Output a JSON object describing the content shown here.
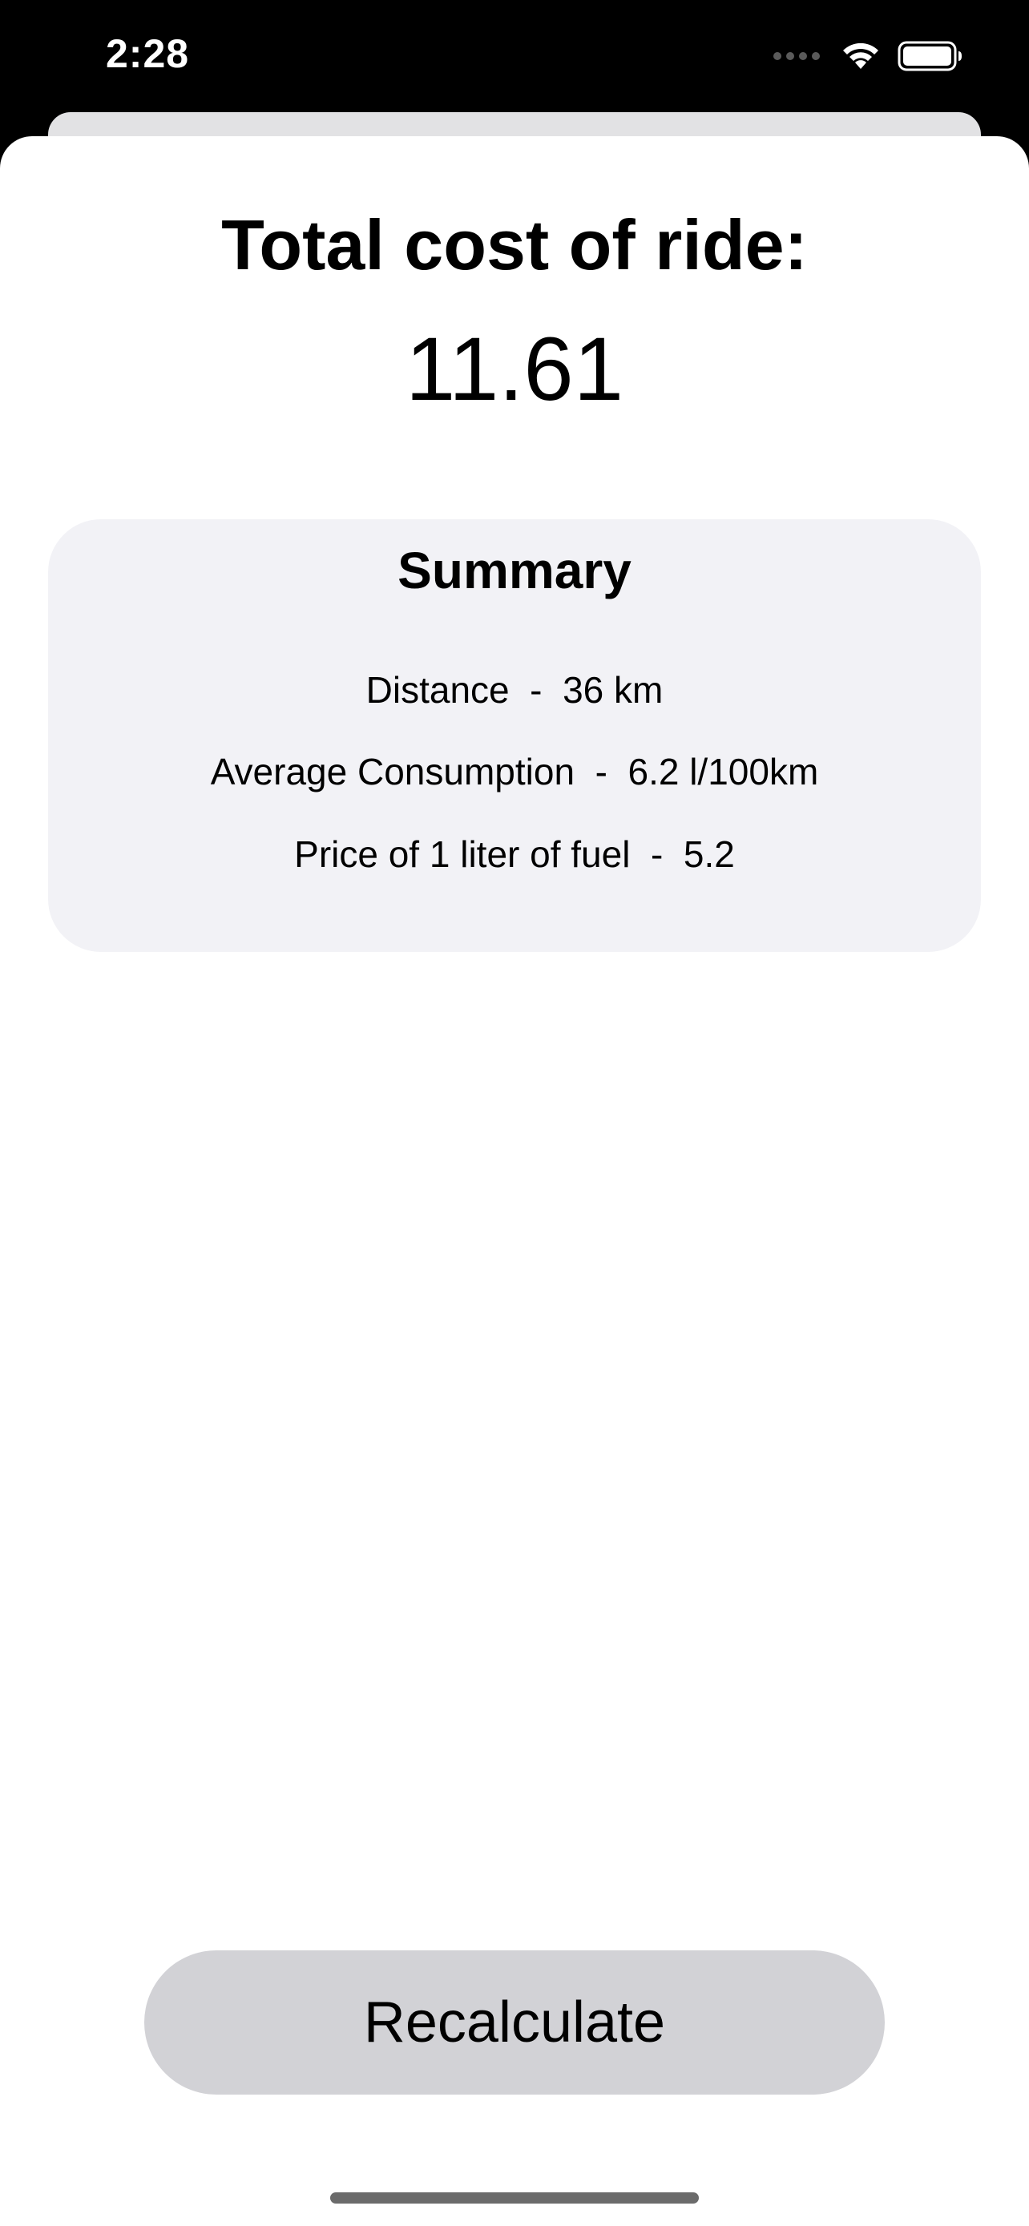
{
  "status_bar": {
    "time": "2:28",
    "icons": [
      "signal-dots-icon",
      "wifi-icon",
      "battery-icon"
    ]
  },
  "result": {
    "title": "Total cost of ride:",
    "total": "11.61"
  },
  "summary": {
    "title": "Summary",
    "rows": [
      {
        "label": "Distance",
        "value": "36 km"
      },
      {
        "label": "Average Consumption",
        "value": "6.2 l/100km"
      },
      {
        "label": "Price of 1 liter of fuel",
        "value": "5.2"
      }
    ]
  },
  "actions": {
    "recalculate_label": "Recalculate"
  },
  "colors": {
    "card_background": "#f2f2f6",
    "button_background": "#d2d2d6",
    "text": "#000000"
  }
}
